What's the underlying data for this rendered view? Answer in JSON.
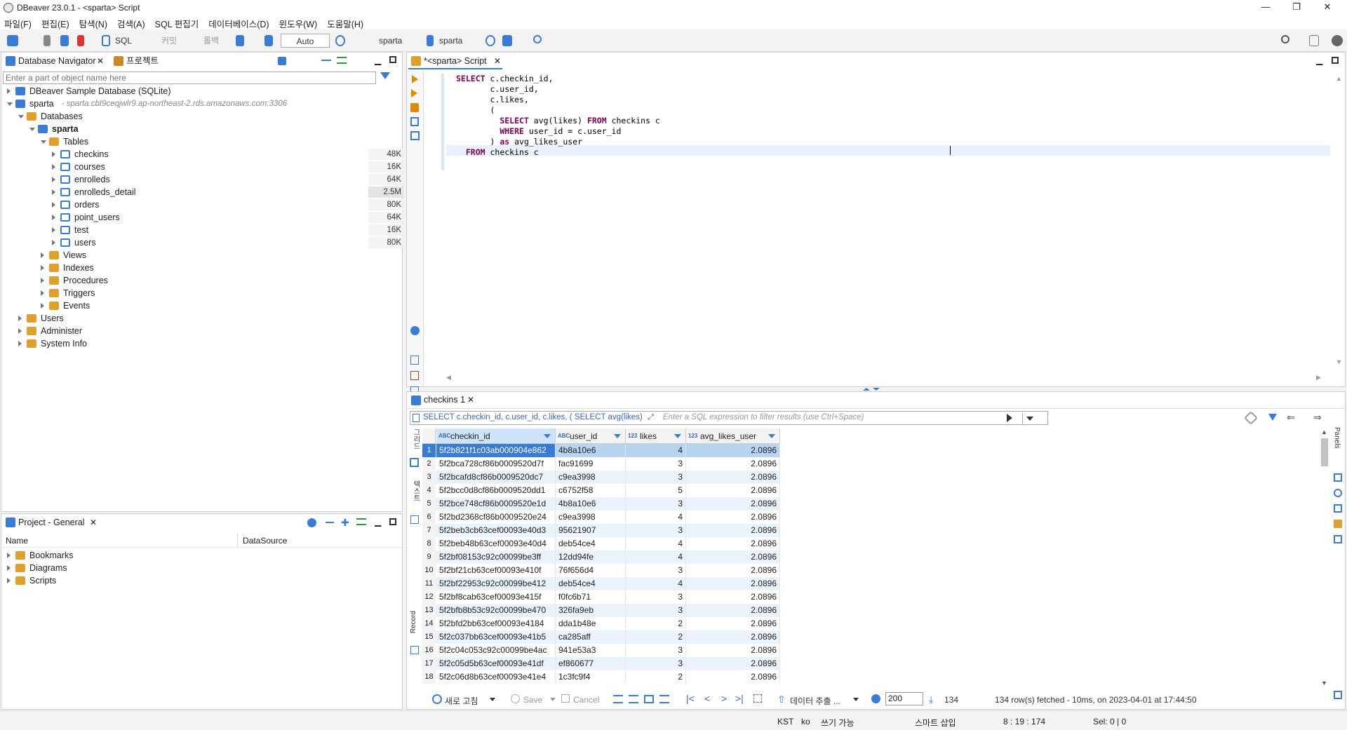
{
  "window": {
    "title": "DBeaver 23.0.1 - <sparta> Script",
    "min": "—",
    "max": "❐",
    "close": "✕"
  },
  "menu": [
    "파일(F)",
    "편집(E)",
    "탐색(N)",
    "검색(A)",
    "SQL 편집기",
    "데이터베이스(D)",
    "윈도우(W)",
    "도움말(H)"
  ],
  "toolbar": {
    "sql": "SQL",
    "commit": "커밋",
    "rollback": "롤백",
    "auto": "Auto",
    "datasource": "sparta",
    "schema": "sparta"
  },
  "navigator": {
    "tab_label": "Database Navigator",
    "tab2_label": "프로젝트",
    "filter_placeholder": "Enter a part of object name here",
    "tree": [
      {
        "label": "DBeaver Sample Database (SQLite)",
        "level": 0,
        "tw": "r",
        "icon": "sqlite"
      },
      {
        "label": "sparta",
        "suffix": " - sparta.cbt9ceqjwlr9.ap-northeast-2.rds.amazonaws.com:3306",
        "level": 0,
        "tw": "d",
        "icon": "conn"
      },
      {
        "label": "Databases",
        "level": 1,
        "tw": "d",
        "icon": "folder"
      },
      {
        "label": "sparta",
        "level": 2,
        "tw": "d",
        "icon": "db",
        "bold": true
      },
      {
        "label": "Tables",
        "level": 3,
        "tw": "d",
        "icon": "folder"
      },
      {
        "label": "checkins",
        "level": 4,
        "tw": "r",
        "icon": "table",
        "size": "48K"
      },
      {
        "label": "courses",
        "level": 4,
        "tw": "r",
        "icon": "table",
        "size": "16K"
      },
      {
        "label": "enrolleds",
        "level": 4,
        "tw": "r",
        "icon": "table",
        "size": "64K"
      },
      {
        "label": "enrolleds_detail",
        "level": 4,
        "tw": "r",
        "icon": "table",
        "size": "2.5M"
      },
      {
        "label": "orders",
        "level": 4,
        "tw": "r",
        "icon": "table",
        "size": "80K"
      },
      {
        "label": "point_users",
        "level": 4,
        "tw": "r",
        "icon": "table",
        "size": "64K"
      },
      {
        "label": "test",
        "level": 4,
        "tw": "r",
        "icon": "table",
        "size": "16K"
      },
      {
        "label": "users",
        "level": 4,
        "tw": "r",
        "icon": "table",
        "size": "80K"
      },
      {
        "label": "Views",
        "level": 3,
        "tw": "r",
        "icon": "folder"
      },
      {
        "label": "Indexes",
        "level": 3,
        "tw": "r",
        "icon": "folder"
      },
      {
        "label": "Procedures",
        "level": 3,
        "tw": "r",
        "icon": "folder"
      },
      {
        "label": "Triggers",
        "level": 3,
        "tw": "r",
        "icon": "folder"
      },
      {
        "label": "Events",
        "level": 3,
        "tw": "r",
        "icon": "folder"
      },
      {
        "label": "Users",
        "level": 1,
        "tw": "r",
        "icon": "folder"
      },
      {
        "label": "Administer",
        "level": 1,
        "tw": "r",
        "icon": "folder"
      },
      {
        "label": "System Info",
        "level": 1,
        "tw": "r",
        "icon": "folder"
      }
    ]
  },
  "project": {
    "tab_label": "Project - General",
    "col_name": "Name",
    "col_datasource": "DataSource",
    "items": [
      "Bookmarks",
      "Diagrams",
      "Scripts"
    ]
  },
  "editor": {
    "tab_label": "*<sparta> Script",
    "sql_lines": [
      [
        {
          "t": "SELECT",
          "k": 1
        },
        {
          "t": " c.checkin_id,"
        }
      ],
      [
        {
          "t": "       c.user_id,"
        }
      ],
      [
        {
          "t": "       c.likes,"
        }
      ],
      [
        {
          "t": "       ("
        }
      ],
      [
        {
          "t": "         "
        },
        {
          "t": "SELECT",
          "k": 1
        },
        {
          "t": " avg(likes) "
        },
        {
          "t": "FROM",
          "k": 1
        },
        {
          "t": " checkins c"
        }
      ],
      [
        {
          "t": "         "
        },
        {
          "t": "WHERE",
          "k": 1
        },
        {
          "t": " user_id = c.user_id"
        }
      ],
      [
        {
          "t": "       ) "
        },
        {
          "t": "as",
          "k": 1
        },
        {
          "t": " avg_likes_user"
        }
      ],
      [
        {
          "t": "  "
        },
        {
          "t": "FROM",
          "k": 1
        },
        {
          "t": " checkins c "
        }
      ]
    ]
  },
  "results": {
    "tab_label": "checkins 1",
    "query_preview": "SELECT c.checkin_id, c.user_id, c.likes, ( SELECT avg(likes)",
    "filter_placeholder": "Enter a SQL expression to filter results (use Ctrl+Space)",
    "side_labels": {
      "grid": "그리드",
      "text": "텍스트",
      "record": "Record",
      "panels": "Panels"
    },
    "columns": [
      {
        "type": "ABC",
        "name": "checkin_id"
      },
      {
        "type": "ABC",
        "name": "user_id"
      },
      {
        "type": "123",
        "name": "likes"
      },
      {
        "type": "123",
        "name": "avg_likes_user"
      }
    ],
    "rows": [
      [
        "1",
        "5f2b821f1c03ab000904e862",
        "4b8a10e6",
        "4",
        "2.0896"
      ],
      [
        "2",
        "5f2bca728cf86b0009520d7f",
        "fac91699",
        "3",
        "2.0896"
      ],
      [
        "3",
        "5f2bcafd8cf86b0009520dc7",
        "c9ea3998",
        "3",
        "2.0896"
      ],
      [
        "4",
        "5f2bcc0d8cf86b0009520dd1",
        "c6752f58",
        "5",
        "2.0896"
      ],
      [
        "5",
        "5f2bce748cf86b0009520e1d",
        "4b8a10e6",
        "3",
        "2.0896"
      ],
      [
        "6",
        "5f2bd2368cf86b0009520e24",
        "c9ea3998",
        "4",
        "2.0896"
      ],
      [
        "7",
        "5f2beb3cb63cef00093e40d3",
        "95621907",
        "3",
        "2.0896"
      ],
      [
        "8",
        "5f2beb48b63cef00093e40d4",
        "deb54ce4",
        "4",
        "2.0896"
      ],
      [
        "9",
        "5f2bf08153c92c00099be3ff",
        "12dd94fe",
        "4",
        "2.0896"
      ],
      [
        "10",
        "5f2bf21cb63cef00093e410f",
        "76f656d4",
        "3",
        "2.0896"
      ],
      [
        "11",
        "5f2bf22953c92c00099be412",
        "deb54ce4",
        "4",
        "2.0896"
      ],
      [
        "12",
        "5f2bf8cab63cef00093e415f",
        "f0fc6b71",
        "3",
        "2.0896"
      ],
      [
        "13",
        "5f2bfb8b53c92c00099be470",
        "326fa9eb",
        "3",
        "2.0896"
      ],
      [
        "14",
        "5f2bfd2bb63cef00093e4184",
        "dda1b48e",
        "2",
        "2.0896"
      ],
      [
        "15",
        "5f2c037bb63cef00093e41b5",
        "ca285aff",
        "2",
        "2.0896"
      ],
      [
        "16",
        "5f2c04c053c92c00099be4ac",
        "941e53a3",
        "3",
        "2.0896"
      ],
      [
        "17",
        "5f2c05d5b63cef00093e41df",
        "ef860677",
        "3",
        "2.0896"
      ],
      [
        "18",
        "5f2c06d8b63cef00093e41e4",
        "1c3fc9f4",
        "2",
        "2.0896"
      ]
    ],
    "bottom": {
      "refresh": "새로 고침",
      "save": "Save",
      "cancel": "Cancel",
      "export": "데이터 추출 ...",
      "fetch_size": "200",
      "row_count": "134",
      "status": "134 row(s) fetched - 10ms, on 2023-04-01 at 17:44:50"
    }
  },
  "statusbar": {
    "tz": "KST",
    "locale": "ko",
    "mode": "쓰기 가능",
    "insert": "스마트 삽입",
    "pos": "8 : 19 : 174",
    "sel": "Sel: 0 | 0"
  }
}
